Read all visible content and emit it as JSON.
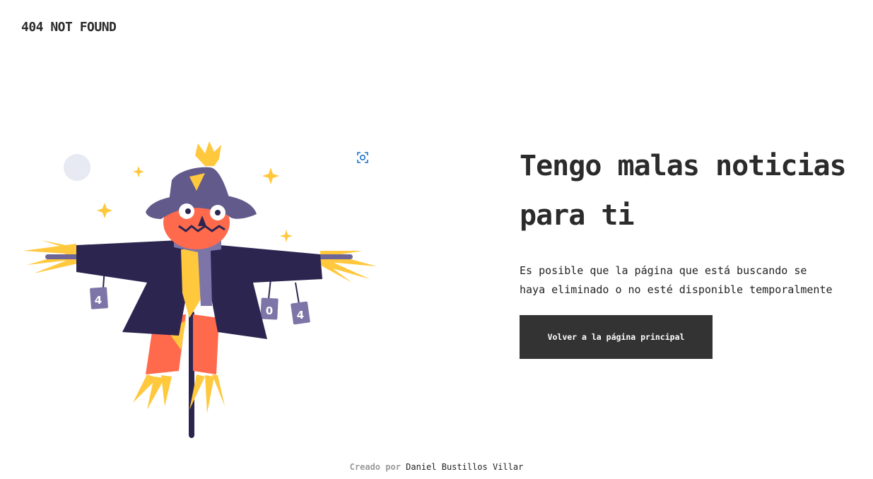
{
  "header": {
    "logo_text": "404 NOT FOUND"
  },
  "illustration": {
    "cans": [
      "4",
      "0",
      "4"
    ]
  },
  "main": {
    "headline_line1": "Tengo malas noticias",
    "headline_line2": "para ti",
    "description_line1": "Es posible que la página que está buscando se",
    "description_line2": "haya eliminado o no esté disponible temporalmente",
    "button_label": "Volver a la página principal"
  },
  "footer": {
    "created_by": "Creado por",
    "author": "Daniel Bustillos Villar"
  },
  "colors": {
    "button_bg": "#333333",
    "coat": "#2c2550",
    "hat": "#635a8c",
    "face": "#ff6a4d",
    "straw": "#ffc83d",
    "can": "#7d75a8",
    "moon": "#e7e9f3"
  }
}
